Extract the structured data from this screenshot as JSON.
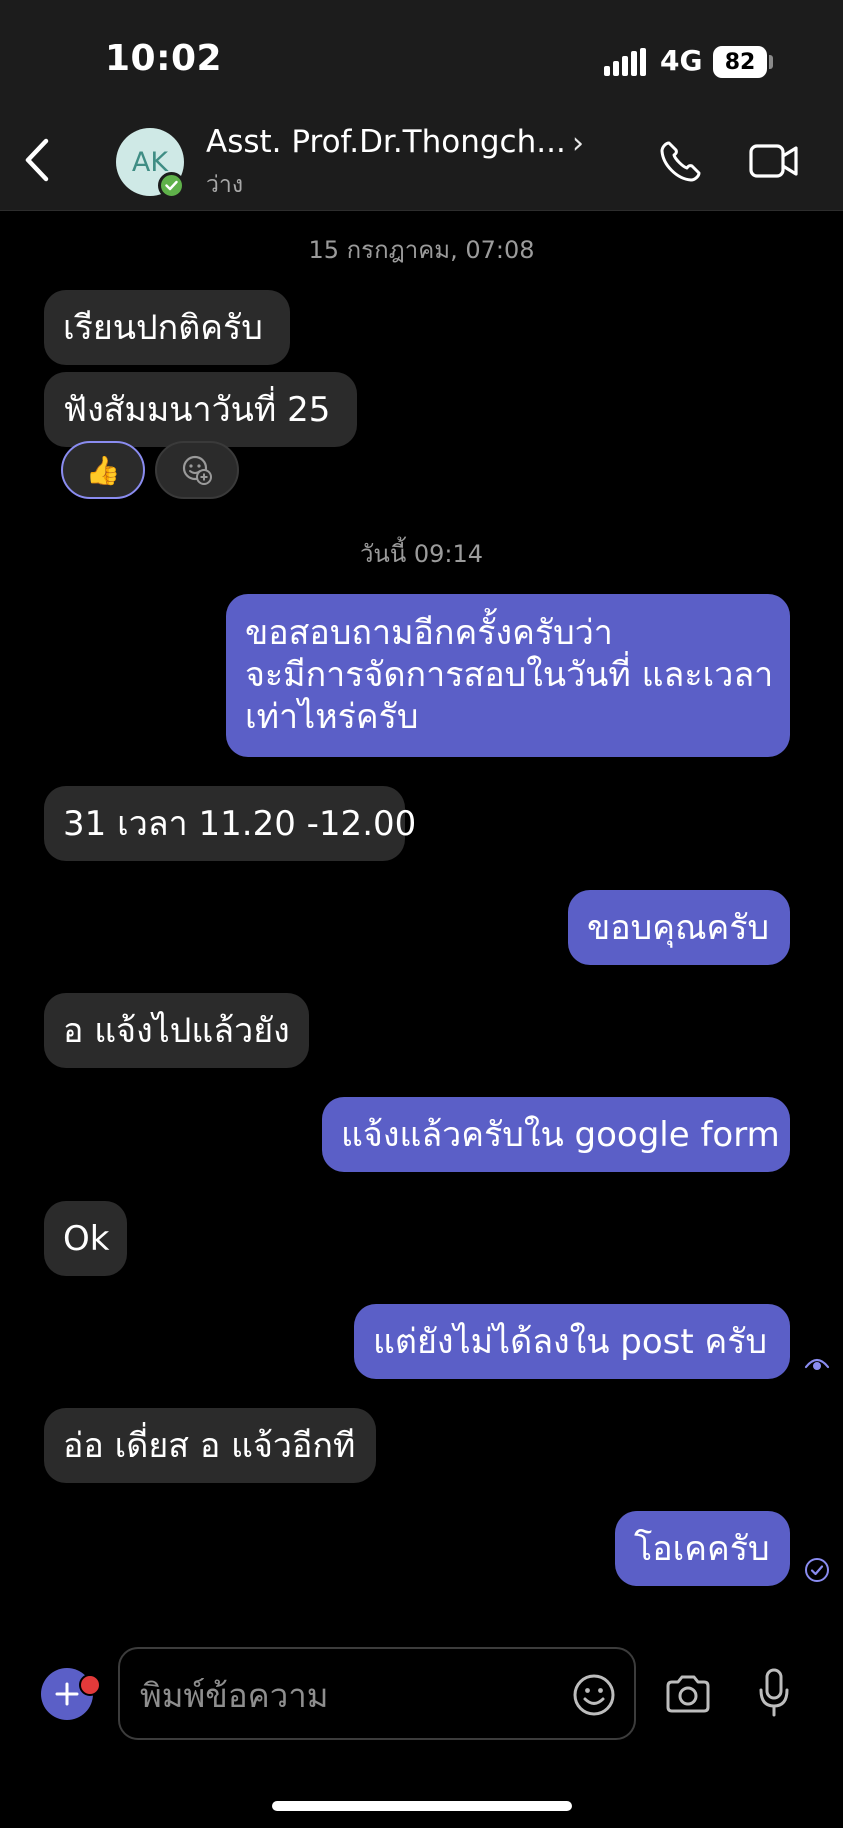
{
  "status_bar": {
    "time": "10:02",
    "network": "4G",
    "battery": "82"
  },
  "header": {
    "avatar_initials": "AK",
    "contact_name": "Asst. Prof.Dr.Thongch...",
    "status": "ว่าง"
  },
  "messages": [
    {
      "type": "date",
      "text": "15 กรกฎาคม, 07:08"
    },
    {
      "type": "in",
      "text": "เรียนปกติครับ"
    },
    {
      "type": "in",
      "text": "ฟังสัมมนาวันที่  25",
      "reaction": "👍"
    },
    {
      "type": "date",
      "text": "วันนี้ 09:14"
    },
    {
      "type": "out",
      "lines": [
        "ขอสอบถามอีกครั้งครับว่า",
        "จะมีการจัดการสอบในวันที่ และเวลา",
        "เท่าไหร่ครับ"
      ]
    },
    {
      "type": "in",
      "text": "31 เวลา 11.20 -12.00"
    },
    {
      "type": "out",
      "text": "ขอบคุณครับ"
    },
    {
      "type": "in",
      "text": "อ แจ้งไปแล้วยัง"
    },
    {
      "type": "out",
      "text": "แจ้งแล้วครับใน google form"
    },
    {
      "type": "in",
      "text": "Ok"
    },
    {
      "type": "out",
      "text": "แต่ยังไม่ได้ลงใน post ครับ"
    },
    {
      "type": "in",
      "text": "อ่อ เดี่ยส อ แจ้วอีกที"
    },
    {
      "type": "out",
      "text": "โอเคครับ"
    }
  ],
  "composer": {
    "placeholder": "พิมพ์ข้อความ"
  },
  "colors": {
    "outgoing": "#5b5fc7",
    "incoming": "#2b2b2b",
    "presence": "#5fb14a"
  },
  "icons": [
    "back-arrow-icon",
    "phone-icon",
    "video-camera-icon",
    "add-reaction-icon",
    "seen-eye-icon",
    "sent-check-icon",
    "plus-icon",
    "smiley-icon",
    "camera-icon",
    "microphone-icon"
  ]
}
